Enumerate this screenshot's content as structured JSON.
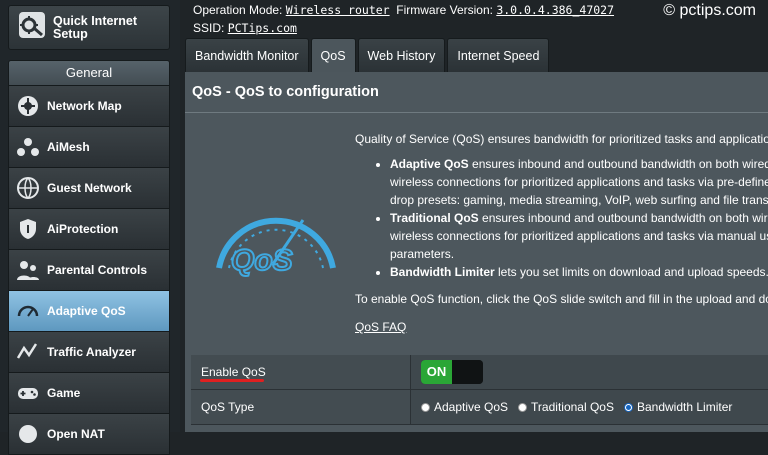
{
  "watermark": "© pctips.com",
  "status": {
    "operation_mode_label": "Operation Mode:",
    "operation_mode_value": "Wireless router",
    "firmware_label": "Firmware Version:",
    "firmware_value": "3.0.0.4.386_47027",
    "ssid_label": "SSID:",
    "ssid_value": "PCTips.com"
  },
  "sidebar": {
    "quick_setup": "Quick Internet Setup",
    "section_title": "General",
    "items": [
      {
        "label": "Network Map",
        "icon": "network-map-icon"
      },
      {
        "label": "AiMesh",
        "icon": "aimesh-icon"
      },
      {
        "label": "Guest Network",
        "icon": "guest-network-icon"
      },
      {
        "label": "AiProtection",
        "icon": "aiprotection-icon"
      },
      {
        "label": "Parental Controls",
        "icon": "parental-controls-icon"
      },
      {
        "label": "Adaptive QoS",
        "icon": "adaptive-qos-icon",
        "active": true
      },
      {
        "label": "Traffic Analyzer",
        "icon": "traffic-analyzer-icon"
      },
      {
        "label": "Game",
        "icon": "game-icon"
      },
      {
        "label": "Open NAT",
        "icon": "open-nat-icon"
      }
    ]
  },
  "tabs": [
    {
      "label": "Bandwidth Monitor"
    },
    {
      "label": "QoS",
      "active": true
    },
    {
      "label": "Web History"
    },
    {
      "label": "Internet Speed"
    }
  ],
  "main": {
    "title": "QoS - QoS to configuration",
    "intro": "Quality of Service (QoS) ensures bandwidth for prioritized tasks and applications.",
    "bullets": [
      {
        "bold": "Adaptive QoS",
        "line1": " ensures inbound and outbound bandwidth on both wired ar",
        "line2": "wireless connections for prioritized applications and tasks via pre-defined, d",
        "line3": "drop presets: gaming, media streaming, VoIP, web surfing and file transferrir"
      },
      {
        "bold": "Traditional QoS",
        "line1": " ensures inbound and outbound bandwidth on both wired",
        "line2": "wireless connections for prioritized applications and tasks via manual user-c",
        "line3": "parameters."
      },
      {
        "bold": "Bandwidth Limiter",
        "line1": " lets you set limits on download and upload speeds."
      }
    ],
    "enable_instruction": "To enable QoS function, click the QoS slide switch and fill in the upload and downlo",
    "faq_link": "QoS FAQ",
    "logo_text": "QoS"
  },
  "settings": {
    "enable_label": "Enable QoS",
    "toggle_state": "ON",
    "type_label": "QoS Type",
    "type_options": [
      "Adaptive QoS",
      "Traditional QoS",
      "Bandwidth Limiter"
    ],
    "type_selected": "Bandwidth Limiter"
  },
  "colors": {
    "active_menu": "#6fa8d0",
    "toggle_on": "#2aa636",
    "red_underline": "#e02020",
    "qos_logo": "#3fa9e0"
  }
}
